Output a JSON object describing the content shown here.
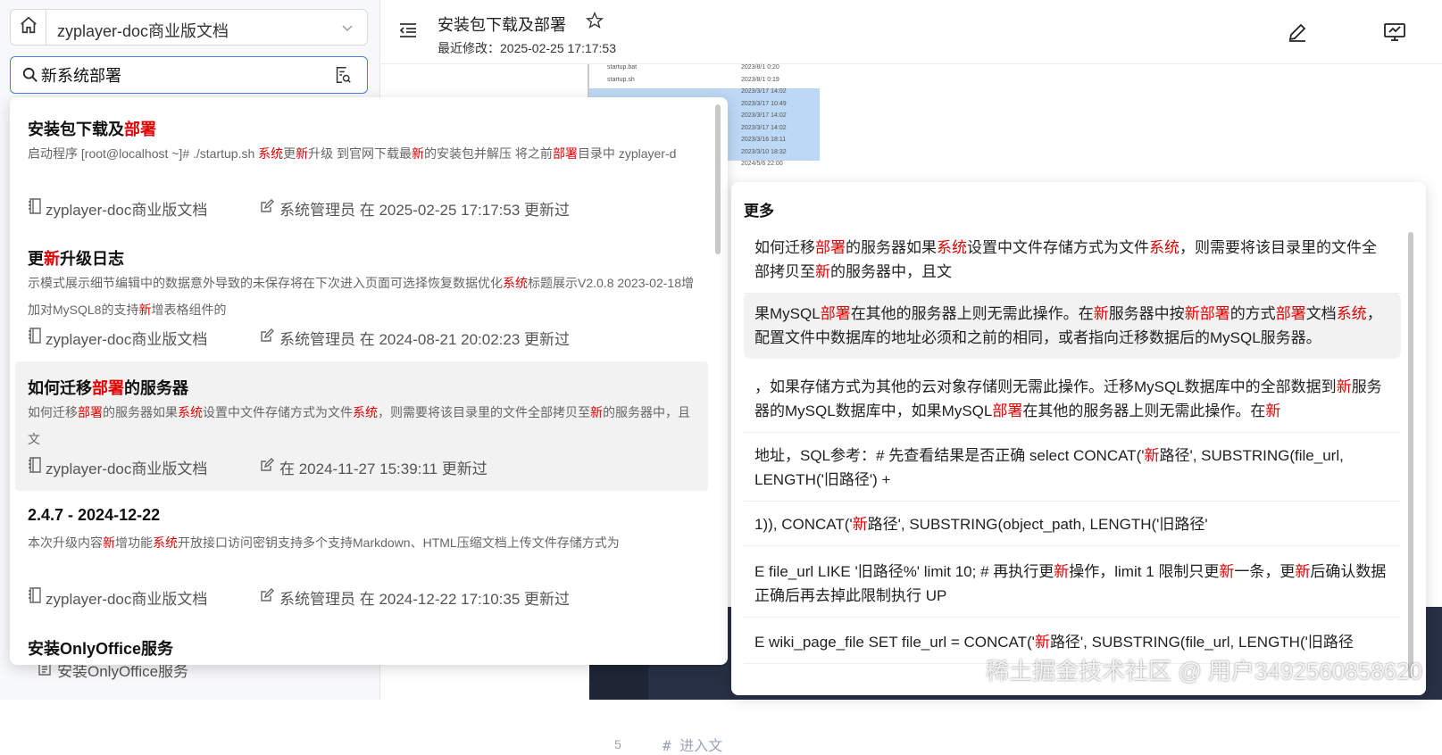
{
  "sidebar": {
    "space_name": "zyplayer-doc商业版文档",
    "search_value": "新系统部署",
    "bottom_doc_label": "安装OnlyOffice服务"
  },
  "header": {
    "title": "安装包下载及部署",
    "modified": "最近修改：2025-02-25 17:17:53"
  },
  "thumbnail_rows": [
    {
      "name": "startup.bat",
      "date": "2023/8/1 0:20",
      "selected": false
    },
    {
      "name": "startup.sh",
      "date": "2023/8/1 0:19",
      "selected": false
    },
    {
      "name": "",
      "date": "2023/3/17 14:02",
      "selected": true
    },
    {
      "name": "",
      "date": "2023/3/17 10:49",
      "selected": true
    },
    {
      "name": "",
      "date": "2023/3/17 14:02",
      "selected": true
    },
    {
      "name": "",
      "date": "2023/3/17 14:02",
      "selected": true
    },
    {
      "name": "",
      "date": "2023/3/16 18:11",
      "selected": true
    },
    {
      "name": "",
      "date": "2023/3/10 18:32",
      "selected": true
    },
    {
      "name": "",
      "date": "2024/5/6 22:00",
      "selected": false
    }
  ],
  "code": {
    "line_number": "5",
    "line_text": "# 进入文"
  },
  "results": [
    {
      "title": [
        {
          "t": "安装包下载及"
        },
        {
          "t": "部署",
          "h": true
        }
      ],
      "snippet": [
        {
          "t": " 启动程序 [root@localhost ~]# ./startup.sh  "
        },
        {
          "t": "系统",
          "h": true
        },
        {
          "t": "更"
        },
        {
          "t": "新",
          "h": true
        },
        {
          "t": "升级  到官网下载最"
        },
        {
          "t": "新",
          "h": true
        },
        {
          "t": "的安装包并解压 将之前"
        },
        {
          "t": "部署",
          "h": true
        },
        {
          "t": "目录中 zyplayer-d"
        }
      ],
      "space": "zyplayer-doc商业版文档",
      "updated": "系统管理员 在 2025-02-25 17:17:53 更新过",
      "active": false
    },
    {
      "title": [
        {
          "t": "更"
        },
        {
          "t": "新",
          "h": true
        },
        {
          "t": "升级日志"
        }
      ],
      "snippet": [
        {
          "t": "示模式展示细节编辑中的数据意外导致的未保存将在下次进入页面可选择恢复数据优化"
        },
        {
          "t": "系统",
          "h": true
        },
        {
          "t": "标题展示V2.0.8    2023-02-18增加对MySQL8的支持"
        },
        {
          "t": "新",
          "h": true
        },
        {
          "t": "增表格组件的"
        }
      ],
      "space": "zyplayer-doc商业版文档",
      "updated": "系统管理员 在 2024-08-21 20:02:23 更新过",
      "active": false
    },
    {
      "title": [
        {
          "t": "如何迁移"
        },
        {
          "t": "部署",
          "h": true
        },
        {
          "t": "的服务器"
        }
      ],
      "snippet": [
        {
          "t": "如何迁移"
        },
        {
          "t": "部署",
          "h": true
        },
        {
          "t": "的服务器如果"
        },
        {
          "t": "系统",
          "h": true
        },
        {
          "t": "设置中文件存储方式为文件"
        },
        {
          "t": "系统",
          "h": true
        },
        {
          "t": "，则需要将该目录里的文件全部拷贝至"
        },
        {
          "t": "新",
          "h": true
        },
        {
          "t": "的服务器中，且文"
        }
      ],
      "space": "zyplayer-doc商业版文档",
      "updated": "在 2024-11-27 15:39:11 更新过",
      "active": true
    },
    {
      "title": [
        {
          "t": "2.4.7 - 2024-12-22"
        }
      ],
      "snippet": [
        {
          "t": "本次升级内容"
        },
        {
          "t": "新",
          "h": true
        },
        {
          "t": "增功能"
        },
        {
          "t": "系统",
          "h": true
        },
        {
          "t": "开放接口访问密钥支持多个支持Markdown、HTML压缩文档上传文件存储方式为"
        }
      ],
      "space": "zyplayer-doc商业版文档",
      "updated": "系统管理员 在 2024-12-22 17:10:35 更新过",
      "active": false
    },
    {
      "title": [
        {
          "t": "安装OnlyOffice服务"
        }
      ],
      "snippet": [],
      "space": "",
      "updated": "",
      "active": false
    }
  ],
  "more": {
    "title": "更多",
    "items": [
      {
        "parts": [
          {
            "t": "如何迁移"
          },
          {
            "t": "部署",
            "h": true
          },
          {
            "t": "的服务器如果"
          },
          {
            "t": "系统",
            "h": true
          },
          {
            "t": "设置中文件存储方式为文件"
          },
          {
            "t": "系统",
            "h": true
          },
          {
            "t": "，则需要将该目录里的文件全部拷贝至"
          },
          {
            "t": "新",
            "h": true
          },
          {
            "t": "的服务器中，且文"
          }
        ],
        "active": false
      },
      {
        "parts": [
          {
            "t": "果MySQL"
          },
          {
            "t": "部署",
            "h": true
          },
          {
            "t": "在其他的服务器上则无需此操作。在"
          },
          {
            "t": "新",
            "h": true
          },
          {
            "t": "服务器中按"
          },
          {
            "t": "新",
            "h": true
          },
          {
            "t": "部署",
            "h": true
          },
          {
            "t": "的方式"
          },
          {
            "t": "部署",
            "h": true
          },
          {
            "t": "文档"
          },
          {
            "t": "系统",
            "h": true
          },
          {
            "t": "，配置文件中数据库的地址必须和之前的相同，或者指向迁移数据后的MySQL服务器。"
          }
        ],
        "active": true
      },
      {
        "parts": [
          {
            "t": "，如果存储方式为其他的云对象存储则无需此操作。迁移MySQL数据库中的全部数据到"
          },
          {
            "t": "新",
            "h": true
          },
          {
            "t": "服务器的MySQL数据库中，如果MySQL"
          },
          {
            "t": "部署",
            "h": true
          },
          {
            "t": "在其他的服务器上则无需此操作。在"
          },
          {
            "t": "新",
            "h": true
          }
        ],
        "active": false
      },
      {
        "parts": [
          {
            "t": "地址，SQL参考：# 先查看结果是否正确 select CONCAT('"
          },
          {
            "t": "新",
            "h": true
          },
          {
            "t": "路径', SUBSTRING(file_url, LENGTH('旧路径') +"
          }
        ],
        "active": false
      },
      {
        "parts": [
          {
            "t": "1)), CONCAT('"
          },
          {
            "t": "新",
            "h": true
          },
          {
            "t": "路径', SUBSTRING(object_path, LENGTH('旧路径'"
          }
        ],
        "active": false
      },
      {
        "parts": [
          {
            "t": "E file_url LIKE '旧路径%' limit 10; # 再执行更"
          },
          {
            "t": "新",
            "h": true
          },
          {
            "t": "操作，limit 1 限制只更"
          },
          {
            "t": "新",
            "h": true
          },
          {
            "t": "一条，更"
          },
          {
            "t": "新",
            "h": true
          },
          {
            "t": "后确认数据正确后再去掉此限制执行 UP"
          }
        ],
        "active": false
      },
      {
        "parts": [
          {
            "t": "E wiki_page_file SET file_url = CONCAT('"
          },
          {
            "t": "新",
            "h": true
          },
          {
            "t": "路径', SUBSTRING(file_url, LENGTH('旧路径"
          }
        ],
        "active": false
      }
    ]
  },
  "watermark": "稀土掘金技术社区 @ 用户3492560858620",
  "colors": {
    "highlight": "#e00000",
    "accent": "#4a7fe0"
  }
}
